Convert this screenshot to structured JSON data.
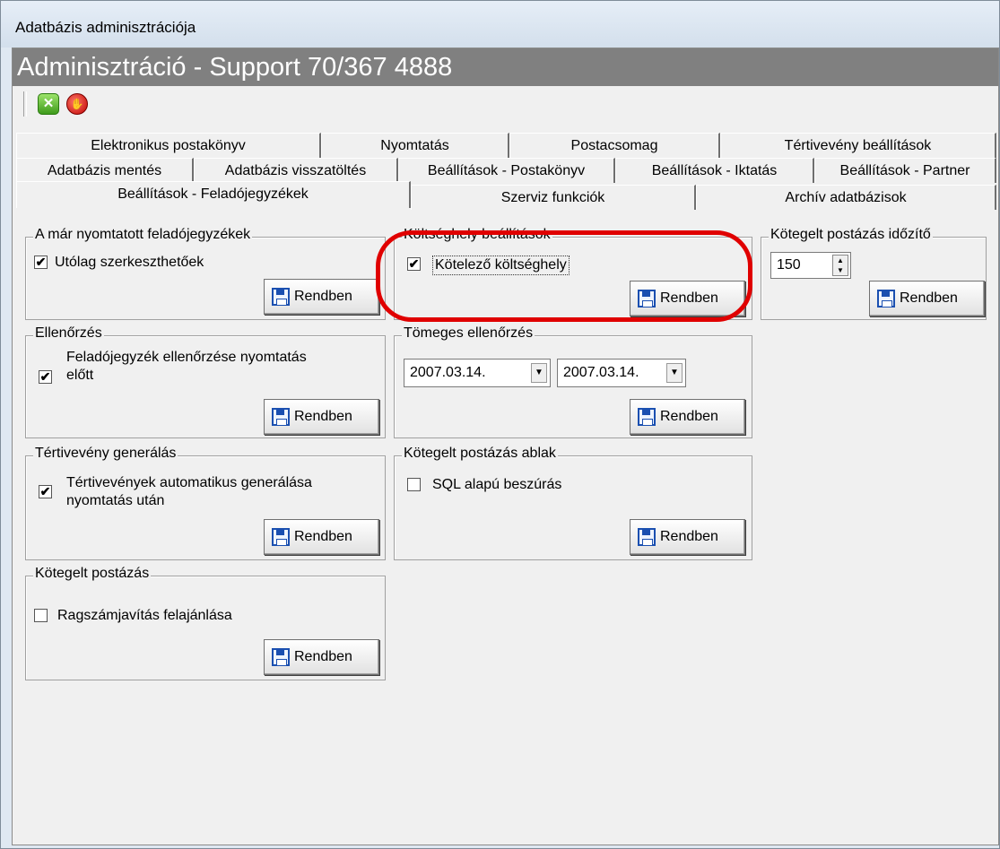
{
  "window": {
    "title": "Adatbázis adminisztrációja"
  },
  "banner": {
    "text": "Adminisztráció - Support 70/367 4888"
  },
  "toolbar": {
    "ok_glyph": "✕",
    "stop_glyph": "✋"
  },
  "tabs": {
    "row1": [
      "Elektronikus postakönyv",
      "Nyomtatás",
      "Postacsomag",
      "Tértivevény beállítások"
    ],
    "row2": [
      "Adatbázis mentés",
      "Adatbázis visszatöltés",
      "Beállítások - Postakönyv",
      "Beállítások - Iktatás",
      "Beállítások - Partner"
    ],
    "row3": [
      "Beállítások - Feladójegyzékek",
      "Szerviz funkciók",
      "Archív adatbázisok"
    ]
  },
  "button_label": "Rendben",
  "groups": {
    "printed_lists": {
      "title": "A már nyomtatott feladójegyzékek",
      "checkbox_label": "Utólag szerkeszthetőek",
      "checked": true
    },
    "cost_center": {
      "title": "Költséghely beállítások",
      "checkbox_label": "Kötelező költséghely",
      "checked": true
    },
    "batch_timer": {
      "title": "Kötegelt postázás időzítő",
      "value": "150"
    },
    "check": {
      "title": "Ellenőrzés",
      "checkbox_label_1": "Feladójegyzék ellenőrzése nyomtatás",
      "checkbox_label_2": "előtt",
      "checked": true
    },
    "mass_check": {
      "title": "Tömeges ellenőrzés",
      "date_from": "2007.03.14.",
      "date_to": "2007.03.14."
    },
    "return_receipt": {
      "title": "Tértivevény generálás",
      "checkbox_label_1": "Tértivevények automatikus generálása",
      "checkbox_label_2": "nyomtatás után",
      "checked": true
    },
    "batch_window": {
      "title": "Kötegelt postázás ablak",
      "checkbox_label": "SQL alapú beszúrás",
      "checked": false
    },
    "batch_mail": {
      "title": "Kötegelt postázás",
      "checkbox_label": "Ragszámjavítás felajánlása",
      "checked": false
    }
  },
  "check_glyph": "✔",
  "arrows": {
    "up": "▲",
    "down": "▼"
  },
  "colors": {
    "banner": "#808080",
    "highlight": "#e00000"
  }
}
